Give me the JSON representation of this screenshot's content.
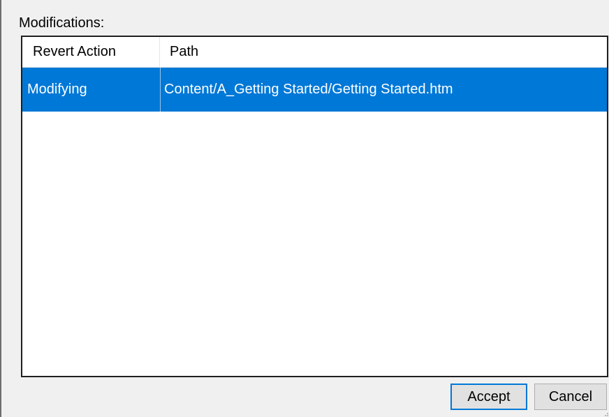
{
  "dialog": {
    "section_label": "Modifications:",
    "columns": [
      "Revert Action",
      "Path"
    ],
    "rows": [
      {
        "action": "Modifying",
        "path": "Content/A_Getting Started/Getting Started.htm",
        "selected": true
      }
    ],
    "buttons": {
      "accept": "Accept",
      "cancel": "Cancel"
    },
    "colors": {
      "selection": "#0078d7",
      "dialog_background": "#f0f0f0",
      "default_button_border": "#0078d7"
    }
  }
}
